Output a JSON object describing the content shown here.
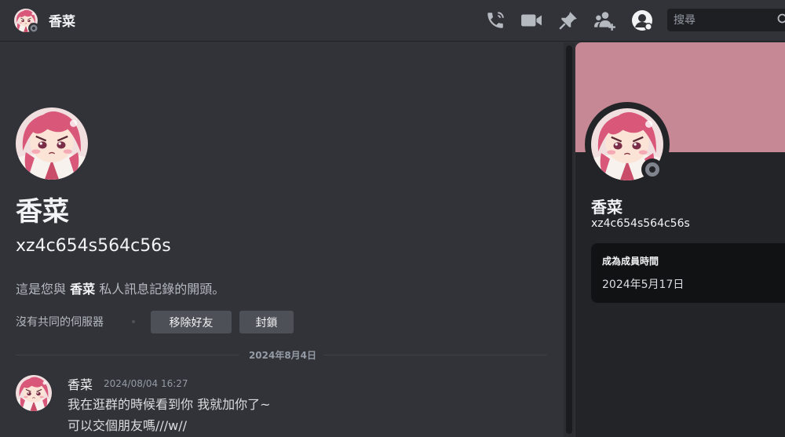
{
  "header": {
    "title": "香菜",
    "icons": [
      "phone-call-icon",
      "video-call-icon",
      "pin-icon",
      "add-friend-icon",
      "profile-icon"
    ],
    "search_placeholder": "搜尋"
  },
  "intro": {
    "name": "香菜",
    "handle": "xz4c654s564c56s",
    "desc_prefix": "這是您與",
    "desc_name": "香菜",
    "desc_suffix": "私人訊息記錄的開頭。",
    "no_mutual_servers": "沒有共同的伺服器",
    "remove_friend_label": "移除好友",
    "block_label": "封鎖"
  },
  "divider": {
    "date": "2024年8月4日"
  },
  "message": {
    "author": "香菜",
    "timestamp": "2024/08/04 16:27",
    "lines": [
      "我在逛群的時候看到你 我就加你了~",
      "可以交個朋友嗎///w//"
    ]
  },
  "profile": {
    "name": "香菜",
    "handle": "xz4c654s564c56s",
    "member_since_label": "成為成員時間",
    "member_since_value": "2024年5月17日"
  },
  "colors": {
    "banner": "#c68895",
    "background": "#313338",
    "panel": "#232428",
    "status_offline": "#80848e"
  }
}
